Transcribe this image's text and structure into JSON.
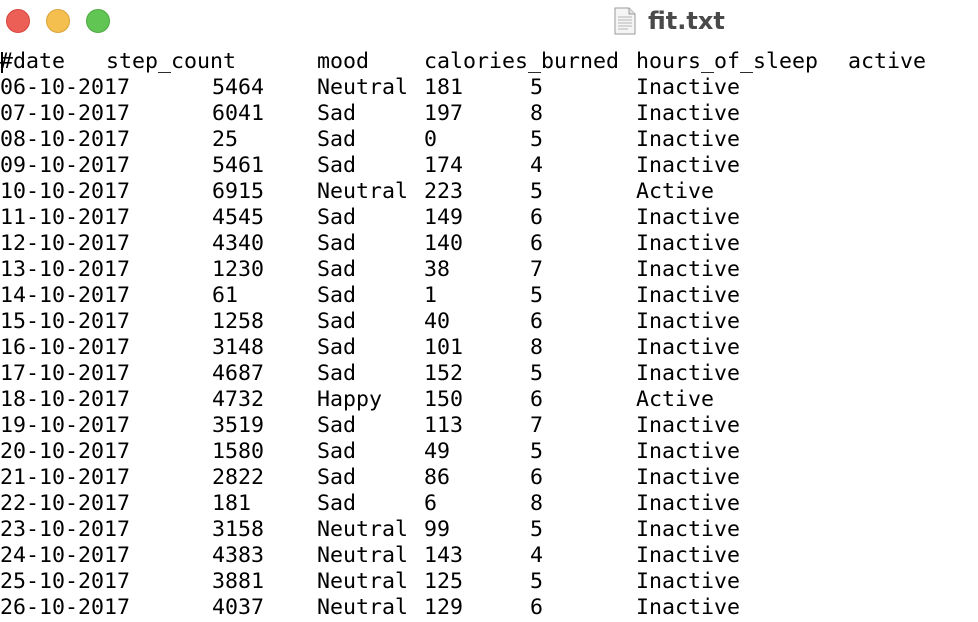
{
  "window": {
    "title": "fit.txt",
    "icon": "text-document-icon",
    "buttons": {
      "close_color": "#ec5f57",
      "minimize_color": "#f4bf4f",
      "zoom_color": "#61c554"
    }
  },
  "file": {
    "header": [
      "#date",
      "step_count",
      "mood",
      "calories_burned",
      "hours_of_sleep",
      "active"
    ],
    "rows": [
      [
        "06-10-2017",
        "5464",
        "Neutral",
        "181",
        "5",
        "Inactive"
      ],
      [
        "07-10-2017",
        "6041",
        "Sad",
        "197",
        "8",
        "Inactive"
      ],
      [
        "08-10-2017",
        "25",
        "Sad",
        "0",
        "5",
        "Inactive"
      ],
      [
        "09-10-2017",
        "5461",
        "Sad",
        "174",
        "4",
        "Inactive"
      ],
      [
        "10-10-2017",
        "6915",
        "Neutral",
        "223",
        "5",
        "Active"
      ],
      [
        "11-10-2017",
        "4545",
        "Sad",
        "149",
        "6",
        "Inactive"
      ],
      [
        "12-10-2017",
        "4340",
        "Sad",
        "140",
        "6",
        "Inactive"
      ],
      [
        "13-10-2017",
        "1230",
        "Sad",
        "38",
        "7",
        "Inactive"
      ],
      [
        "14-10-2017",
        "61",
        "Sad",
        "1",
        "5",
        "Inactive"
      ],
      [
        "15-10-2017",
        "1258",
        "Sad",
        "40",
        "6",
        "Inactive"
      ],
      [
        "16-10-2017",
        "3148",
        "Sad",
        "101",
        "8",
        "Inactive"
      ],
      [
        "17-10-2017",
        "4687",
        "Sad",
        "152",
        "5",
        "Inactive"
      ],
      [
        "18-10-2017",
        "4732",
        "Happy",
        "150",
        "6",
        "Active"
      ],
      [
        "19-10-2017",
        "3519",
        "Sad",
        "113",
        "7",
        "Inactive"
      ],
      [
        "20-10-2017",
        "1580",
        "Sad",
        "49",
        "5",
        "Inactive"
      ],
      [
        "21-10-2017",
        "2822",
        "Sad",
        "86",
        "6",
        "Inactive"
      ],
      [
        "22-10-2017",
        "181",
        "Sad",
        "6",
        "8",
        "Inactive"
      ],
      [
        "23-10-2017",
        "3158",
        "Neutral",
        "99",
        "5",
        "Inactive"
      ],
      [
        "24-10-2017",
        "4383",
        "Neutral",
        "143",
        "4",
        "Inactive"
      ],
      [
        "25-10-2017",
        "3881",
        "Neutral",
        "125",
        "5",
        "Inactive"
      ],
      [
        "26-10-2017",
        "4037",
        "Neutral",
        "129",
        "6",
        "Inactive"
      ]
    ]
  }
}
